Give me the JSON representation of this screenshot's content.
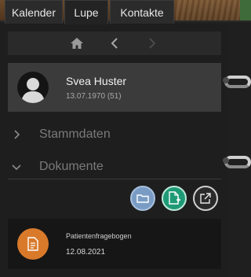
{
  "tabs": [
    {
      "label": "Kalender"
    },
    {
      "label": "Lupe"
    },
    {
      "label": "Kontakte"
    }
  ],
  "nav": {
    "home_icon": "home-icon",
    "back_icon": "chevron-left-icon",
    "forward_icon": "chevron-right-icon"
  },
  "patient": {
    "name": "Svea Huster",
    "dob": "13.07.1970 (51)"
  },
  "sections": {
    "stammdaten": "Stammdaten",
    "dokumente": "Dokumente"
  },
  "actions": {
    "folder_icon": "folder-icon",
    "add_document_icon": "add-document-icon",
    "export_icon": "export-icon"
  },
  "document": {
    "title": "Patientenfragebogen",
    "date": "12.08.2021"
  },
  "colors": {
    "accent_blue": "#7a9cc4",
    "accent_green": "#1f9a77",
    "document_orange": "#d97a2b",
    "card_bg": "#3b3b3b"
  }
}
